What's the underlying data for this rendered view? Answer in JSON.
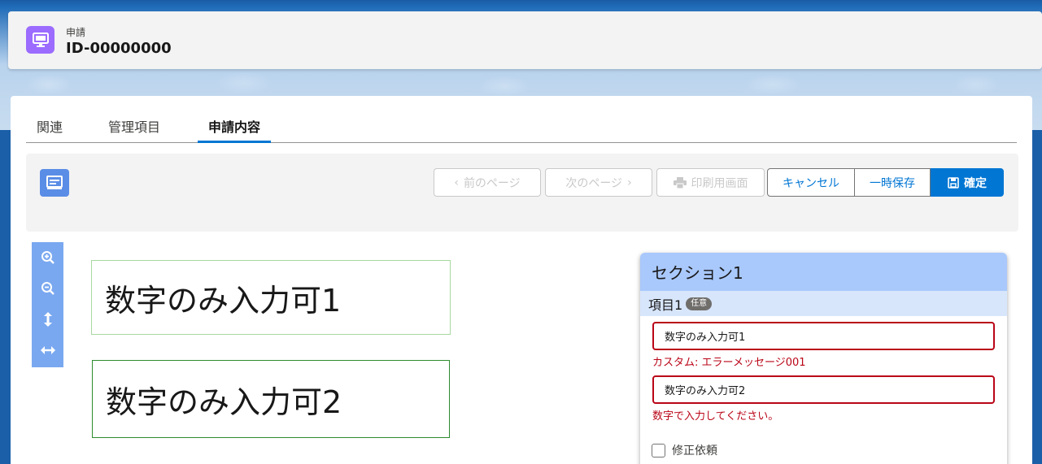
{
  "header": {
    "object_label": "申請",
    "record_id": "ID-00000000"
  },
  "tabs": [
    {
      "label": "関連"
    },
    {
      "label": "管理項目"
    },
    {
      "label": "申請内容"
    }
  ],
  "toolbar": {
    "prev_label": "前のページ",
    "next_label": "次のページ",
    "print_label": "印刷用画面",
    "cancel_label": "キャンセル",
    "save_draft_label": "一時保存",
    "confirm_label": "確定"
  },
  "document": {
    "field1_text": "数字のみ入力可1",
    "field2_text": "数字のみ入力可2"
  },
  "panel": {
    "section_title": "セクション1",
    "item_label": "項目1",
    "optional_badge": "任意",
    "input1_value": "数字のみ入力可1",
    "input1_error": "カスタム: エラーメッセージ001",
    "input2_value": "数字のみ入力可2",
    "input2_error": "数字で入力してください。",
    "checkbox_label": "修正依頼"
  },
  "colors": {
    "brand_blue": "#0176d3",
    "error_red": "#ba0517",
    "header_icon_purple": "#9b6cff"
  }
}
